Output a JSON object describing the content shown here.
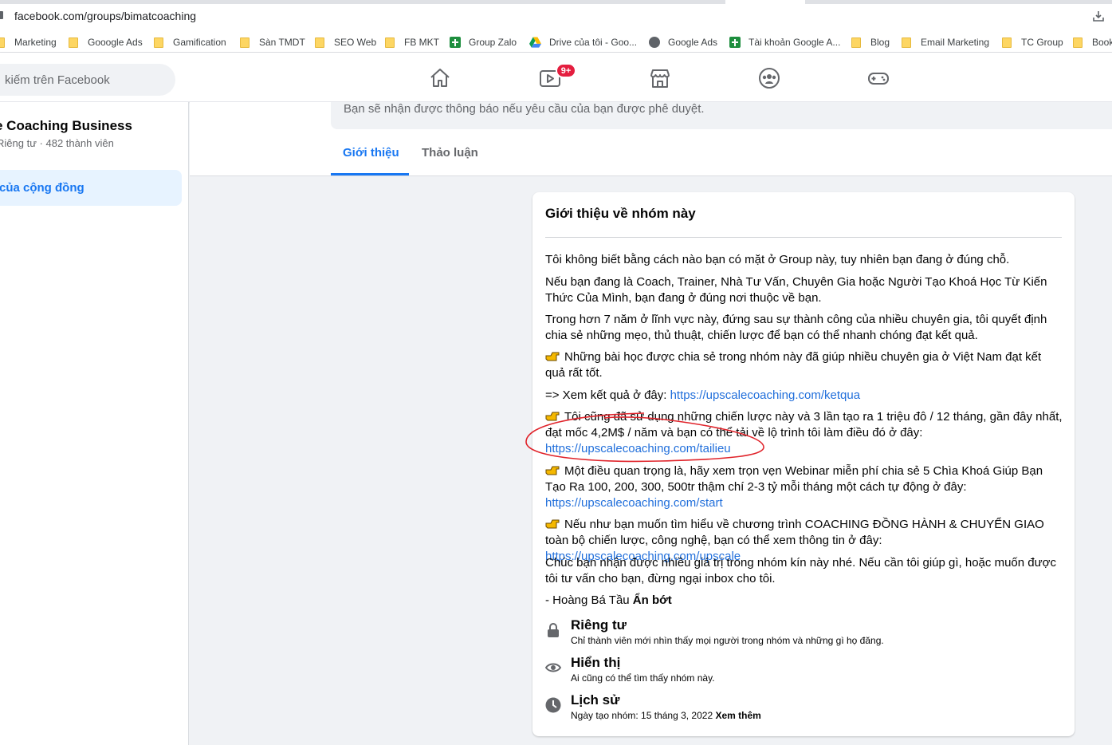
{
  "browser": {
    "url": "facebook.com/groups/bimatcoaching",
    "bookmarks": [
      {
        "label": "Marketing",
        "type": "folder"
      },
      {
        "label": "Gooogle Ads",
        "type": "folder"
      },
      {
        "label": "Gamification",
        "type": "folder"
      },
      {
        "label": "Sàn TMDT",
        "type": "folder"
      },
      {
        "label": "SEO Web",
        "type": "folder"
      },
      {
        "label": "FB MKT",
        "type": "folder"
      },
      {
        "label": "Group Zalo",
        "type": "sheet"
      },
      {
        "label": "Drive của tôi - Goo...",
        "type": "drive"
      },
      {
        "label": "Google Ads",
        "type": "globe"
      },
      {
        "label": "Tài khoản Google A...",
        "type": "sheet"
      },
      {
        "label": "Blog",
        "type": "folder"
      },
      {
        "label": "Email Marketing",
        "type": "folder"
      },
      {
        "label": "TC Group",
        "type": "folder"
      },
      {
        "label": "Book",
        "type": "folder"
      }
    ]
  },
  "header": {
    "search_placeholder": "kiếm trên Facebook",
    "watch_badge": "9+",
    "nav_icons": [
      "home-icon",
      "watch-icon",
      "marketplace-icon",
      "groups-icon",
      "gaming-icon"
    ]
  },
  "sidebar": {
    "group_name": "e Coaching Business",
    "privacy": "Riêng tư",
    "separator": "·",
    "members": "482 thành viên",
    "active_item": "của cộng đồng"
  },
  "main": {
    "notice": "Bạn sẽ nhận được thông báo nếu yêu cầu của bạn được phê duyệt.",
    "tabs": [
      "Giới thiệu",
      "Thảo luận"
    ]
  },
  "about": {
    "title": "Giới thiệu về nhóm này",
    "p1": "Tôi không biết bằng cách nào bạn có mặt ở Group này, tuy nhiên bạn đang ở đúng chỗ.",
    "p2": "Nếu bạn đang là Coach, Trainer, Nhà Tư Vấn, Chuyên Gia hoặc Người Tạo Khoá Học Từ Kiến Thức Của Mình, bạn đang ở đúng nơi thuộc về bạn.",
    "p3": "Trong hơn 7 năm ở lĩnh vực này, đứng sau sự thành công của nhiều chuyên gia, tôi quyết định chia sẻ những mẹo, thủ thuật, chiến lược để bạn có thể nhanh chóng đạt kết quả.",
    "p4": "Những bài học được chia sẻ trong nhóm này đã giúp nhiều chuyên gia ở Việt Nam đạt kết quả rất tốt.",
    "p5_text": "=> Xem kết quả ở đây: ",
    "p5_link": "https://upscalecoaching.com/ketqua",
    "p6_text": "Tôi cũng đã sử dụng những chiến lược này và 3 lần tạo ra 1 triệu đô / 12 tháng, gần đây nhất, đạt mốc 4,2M$ / năm và bạn có thể tải về lộ trình tôi làm điều đó ở đây:",
    "p6_link": "https://upscalecoaching.com/tailieu",
    "p7_text": "Một điều quan trọng là, hãy xem trọn vẹn Webinar miễn phí chia sẻ 5 Chìa Khoá Giúp Bạn Tạo Ra 100, 200, 300, 500tr thậm chí 2-3 tỷ mỗi tháng một cách tự động ở đây:",
    "p7_link": "https://upscalecoaching.com/start",
    "p8_text": "Nếu như bạn muốn tìm hiểu về chương trình COACHING ĐỒNG HÀNH & CHUYỂN GIAO toàn bộ chiến lược, công nghệ, bạn có thể xem thông tin ở đây: ",
    "p8_link": "https://upscalecoaching.com/upscale",
    "p9": "Chúc bạn nhận được nhiều giá trị trong nhóm kín này nhé. Nếu cần tôi giúp gì, hoặc muốn được tôi tư vấn cho bạn, đừng ngại inbox cho tôi.",
    "signature": "- Hoàng Bá Tầu ",
    "see_less": "Ẩn bớt",
    "privacy_title": "Riêng tư",
    "privacy_sub": "Chỉ thành viên mới nhìn thấy mọi người trong nhóm và những gì họ đăng.",
    "visibility_title": "Hiển thị",
    "visibility_sub": "Ai cũng có thể tìm thấy nhóm này.",
    "history_title": "Lịch sử",
    "history_sub": "Ngày tạo nhóm: 15 tháng 3, 2022 ",
    "see_more": "Xem thêm"
  },
  "colors": {
    "accent": "#1877f2",
    "link": "#216fdb",
    "annotation": "#e0242b"
  }
}
